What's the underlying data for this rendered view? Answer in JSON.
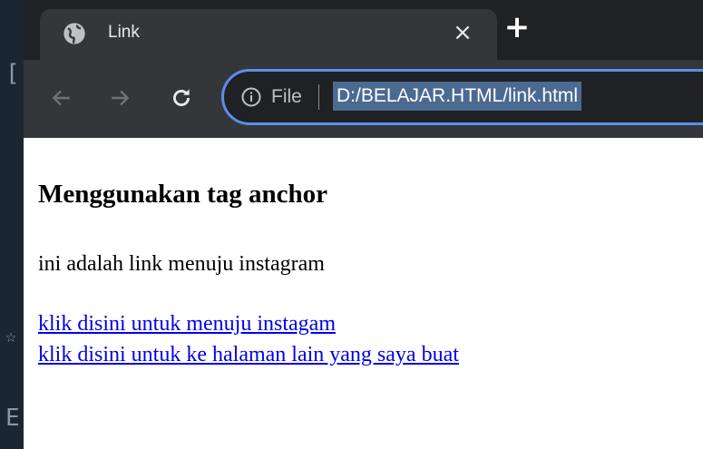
{
  "browser": {
    "tab": {
      "title": "Link",
      "icon": "globe-icon",
      "close_glyph": "×"
    },
    "new_tab_glyph": "+",
    "nav": {
      "back_icon": "arrow-left-icon",
      "forward_icon": "arrow-right-icon",
      "reload_icon": "reload-icon"
    },
    "address_bar": {
      "scheme_label": "File",
      "url": "D:/BELAJAR.HTML/link.html"
    },
    "colors": {
      "tabstrip": "#202124",
      "toolbar": "#35363a",
      "omnibox_focus": "#5c8ee8",
      "url_selection": "#4b6a91"
    }
  },
  "page": {
    "heading": "Menggunakan tag anchor",
    "description": "ini adalah link menuju instagram",
    "links": [
      {
        "label": "klik disini untuk menuju instagam"
      },
      {
        "label": "klik disini untuk ke halaman lain yang saya buat"
      }
    ],
    "link_color": "#0000ee"
  }
}
